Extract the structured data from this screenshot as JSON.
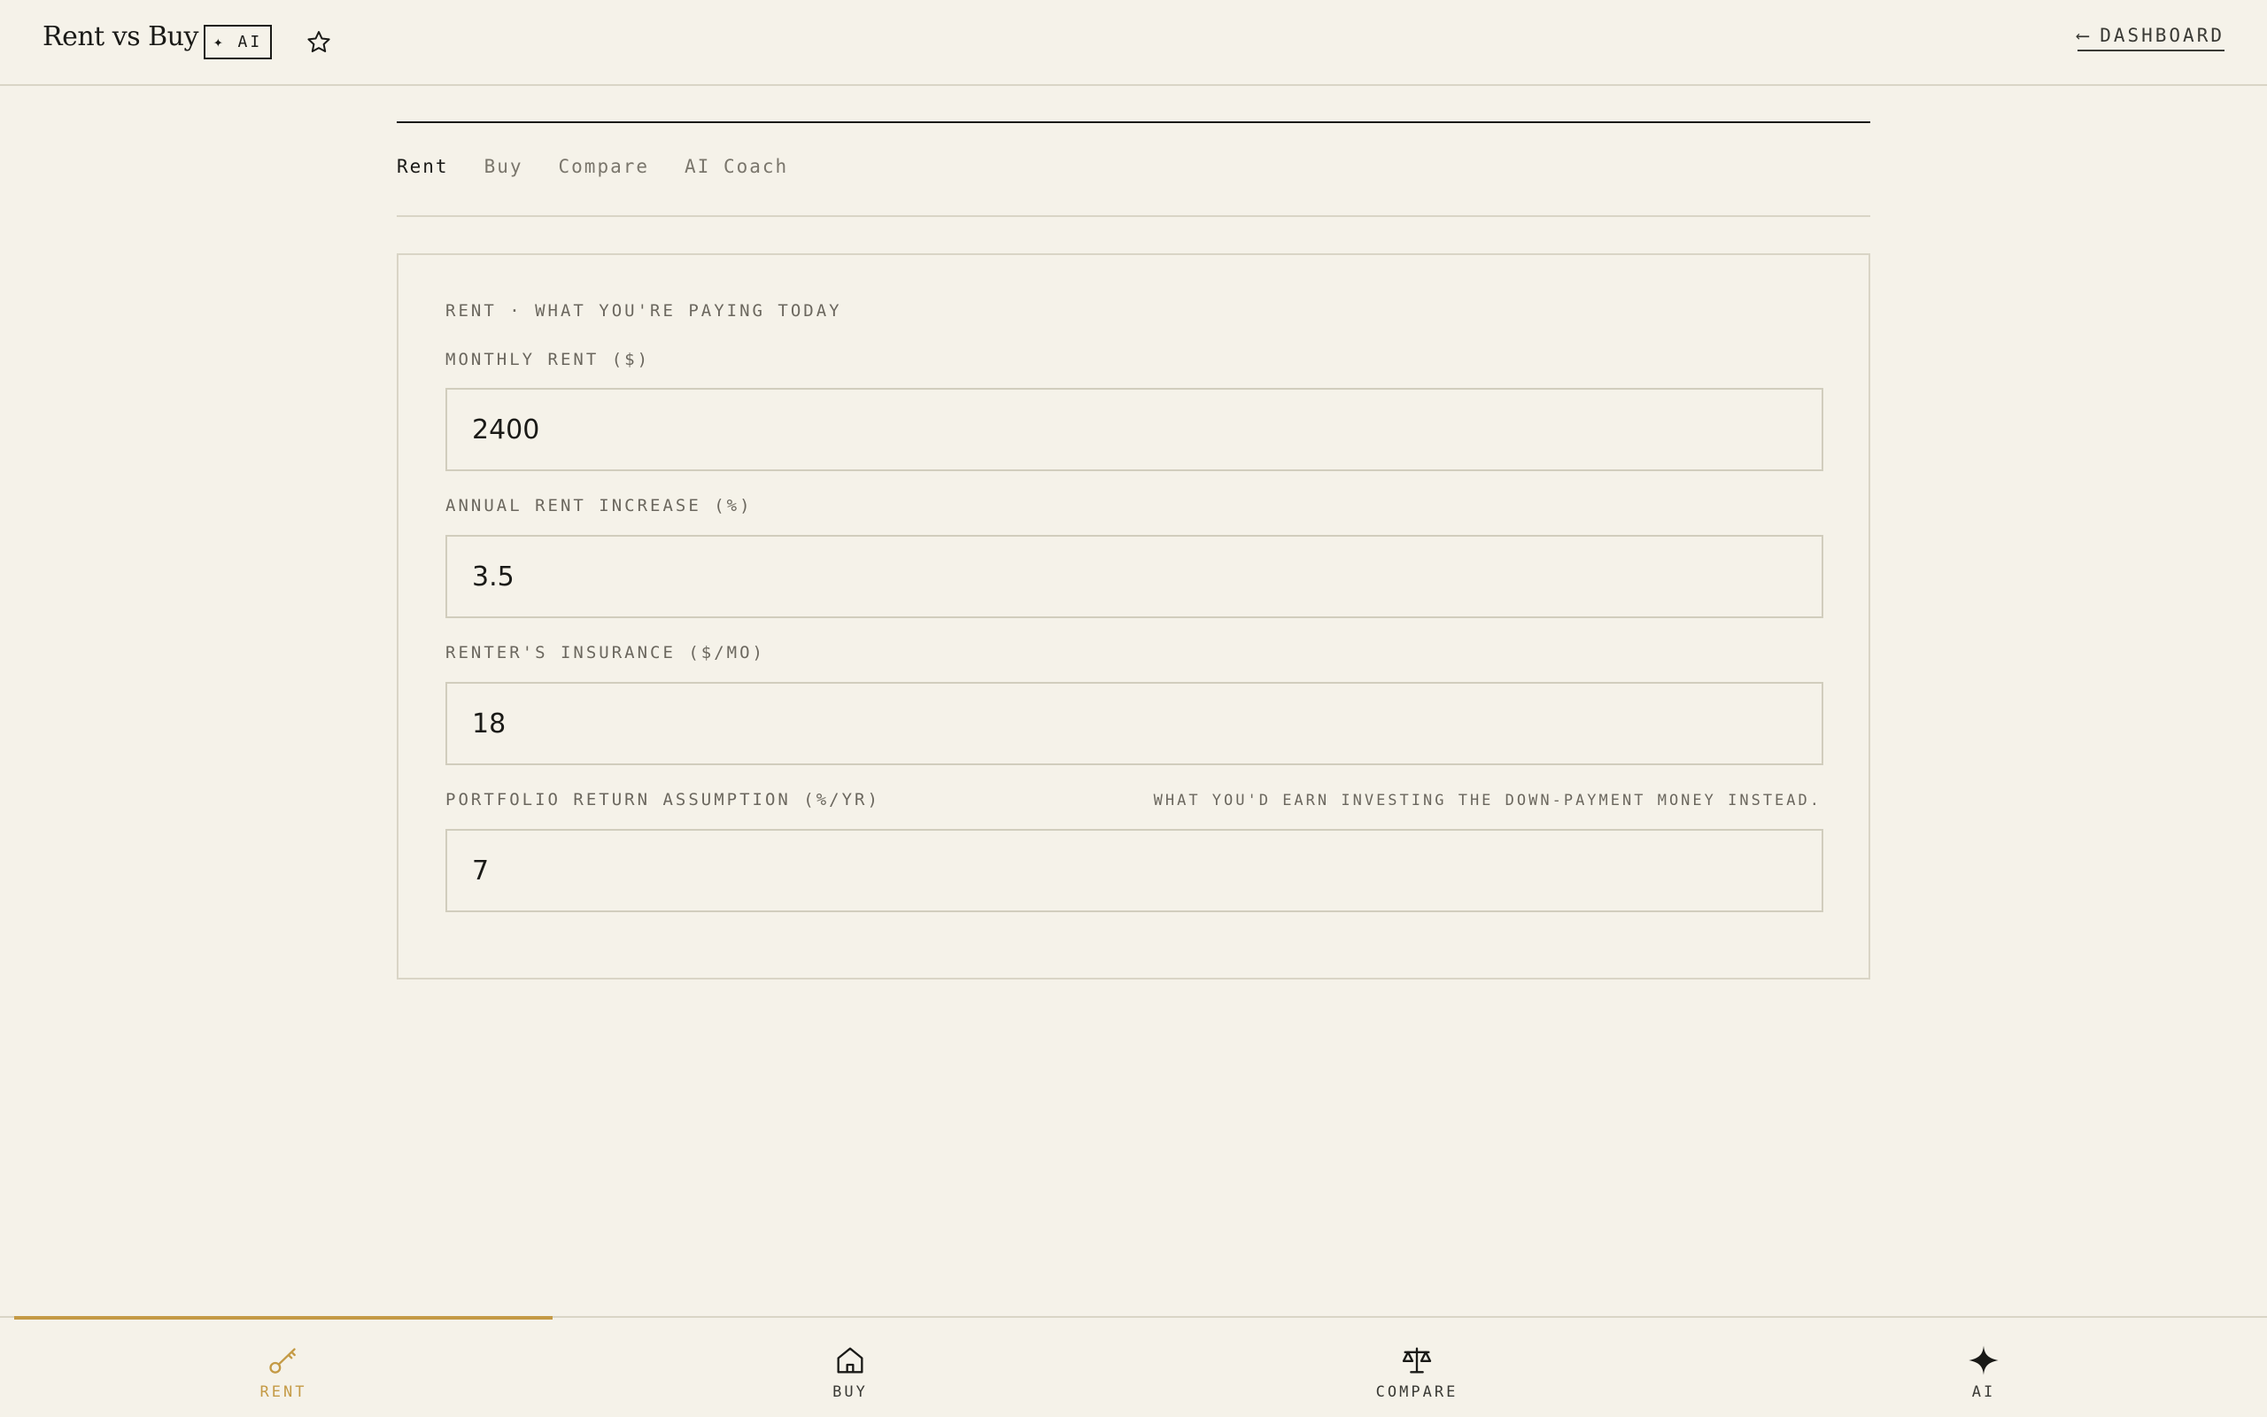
{
  "header": {
    "title": "Rent vs Buy",
    "ai_badge": "✦ AI",
    "dashboard_link": "DASHBOARD",
    "dashboard_arrow": "⟵"
  },
  "tabs": [
    {
      "label": "Rent",
      "active": true
    },
    {
      "label": "Buy",
      "active": false
    },
    {
      "label": "Compare",
      "active": false
    },
    {
      "label": "AI Coach",
      "active": false
    }
  ],
  "card": {
    "heading": "RENT · WHAT YOU'RE PAYING TODAY",
    "fields": [
      {
        "label": "MONTHLY RENT ($)",
        "value": "2400"
      },
      {
        "label": "ANNUAL RENT INCREASE (%)",
        "value": "3.5"
      },
      {
        "label": "RENTER'S INSURANCE ($/MO)",
        "value": "18"
      },
      {
        "label": "PORTFOLIO RETURN ASSUMPTION (%/YR)",
        "value": "7",
        "hint": "WHAT YOU'D EARN INVESTING THE DOWN-PAYMENT MONEY INSTEAD."
      }
    ]
  },
  "bottom_nav": [
    {
      "label": "RENT",
      "icon": "key-icon",
      "active": true
    },
    {
      "label": "BUY",
      "icon": "house-icon",
      "active": false
    },
    {
      "label": "COMPARE",
      "icon": "scale-icon",
      "active": false
    },
    {
      "label": "AI",
      "icon": "sparkle-icon",
      "active": false
    }
  ],
  "colors": {
    "background": "#f5f2e9",
    "accent": "#c49a45",
    "text": "#1a1a17",
    "muted": "#6b675e",
    "border": "#d9d5c6"
  }
}
